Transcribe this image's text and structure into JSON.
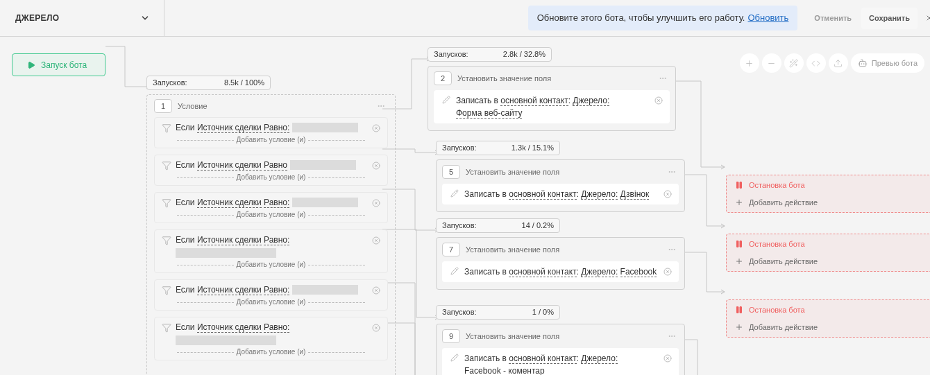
{
  "header": {
    "title": "ДЖЕРЕЛО",
    "notice": {
      "text": "Обновите этого бота, чтобы улучшить его работу.",
      "link": "Обновить"
    },
    "cancel": "Отменить",
    "save": "Сохранить"
  },
  "toolbar": {
    "preview": "Превью бота"
  },
  "start_node": {
    "label": "Запуск бота"
  },
  "condition_node": {
    "number": "1",
    "title": "Условие",
    "stats": {
      "label": "Запусков:",
      "value": "8.5k / 100%"
    },
    "conditions": [
      {
        "prefix": "Если",
        "field": "Источник сделки",
        "operator": "Равно:",
        "value_on_new_line": false,
        "add_label": "Добавить условие (и)"
      },
      {
        "prefix": "Если",
        "field": "Источник сделки",
        "operator": "Равно",
        "value_on_new_line": false,
        "add_label": "Добавить условие (и)"
      },
      {
        "prefix": "Если",
        "field": "Источник сделки",
        "operator": "Равно:",
        "value_on_new_line": false,
        "add_label": "Добавить условие (и)"
      },
      {
        "prefix": "Если",
        "field": "Источник сделки",
        "operator": "Равно:",
        "value_on_new_line": true,
        "add_label": "Добавить условие (и)"
      },
      {
        "prefix": "Если",
        "field": "Источник сделки",
        "operator": "Равно:",
        "value_on_new_line": false,
        "add_label": "Добавить условие (и)"
      },
      {
        "prefix": "Если",
        "field": "Источник сделки",
        "operator": "Равно:",
        "value_on_new_line": true,
        "add_label": "Добавить условие (и)"
      }
    ]
  },
  "action_nodes": [
    {
      "number": "2",
      "title": "Установить значение поля",
      "stats": {
        "label": "Запусков:",
        "value": "2.8k / 32.8%"
      },
      "action": [
        {
          "text": "Записать в",
          "link": false
        },
        {
          "text": "основной контакт",
          "link": true
        },
        {
          "text": ":",
          "link": false
        },
        {
          "text": "Джерело:",
          "link": true
        },
        {
          "text": "Форма веб-сайту",
          "link": true
        }
      ]
    },
    {
      "number": "5",
      "title": "Установить значение поля",
      "stats": {
        "label": "Запусков:",
        "value": "1.3k / 15.1%"
      },
      "action": [
        {
          "text": "Записать в",
          "link": false
        },
        {
          "text": "основной контакт",
          "link": true
        },
        {
          "text": ":",
          "link": false
        },
        {
          "text": "Джерело:",
          "link": true
        },
        {
          "text": "Дзвінок",
          "link": true
        }
      ]
    },
    {
      "number": "7",
      "title": "Установить значение поля",
      "stats": {
        "label": "Запусков:",
        "value": "14 / 0.2%"
      },
      "action": [
        {
          "text": "Записать в",
          "link": false
        },
        {
          "text": "основной контакт",
          "link": true
        },
        {
          "text": ":",
          "link": false
        },
        {
          "text": "Джерело:",
          "link": true
        },
        {
          "text": "Facebook",
          "link": true
        }
      ]
    },
    {
      "number": "9",
      "title": "Установить значение поля",
      "stats": {
        "label": "Запусков:",
        "value": "1 / 0%"
      },
      "action": [
        {
          "text": "Записать в",
          "link": false
        },
        {
          "text": "основной контакт",
          "link": true
        },
        {
          "text": ":",
          "link": false
        },
        {
          "text": "Джерело:",
          "link": true
        },
        {
          "text": "Facebook - коментар",
          "link": true
        }
      ]
    }
  ],
  "stop_nodes": [
    {
      "title": "Остановка бота",
      "add_label": "Добавить действие"
    },
    {
      "title": "Остановка бота",
      "add_label": "Добавить действие"
    },
    {
      "title": "Остановка бота",
      "add_label": "Добавить действие"
    }
  ]
}
